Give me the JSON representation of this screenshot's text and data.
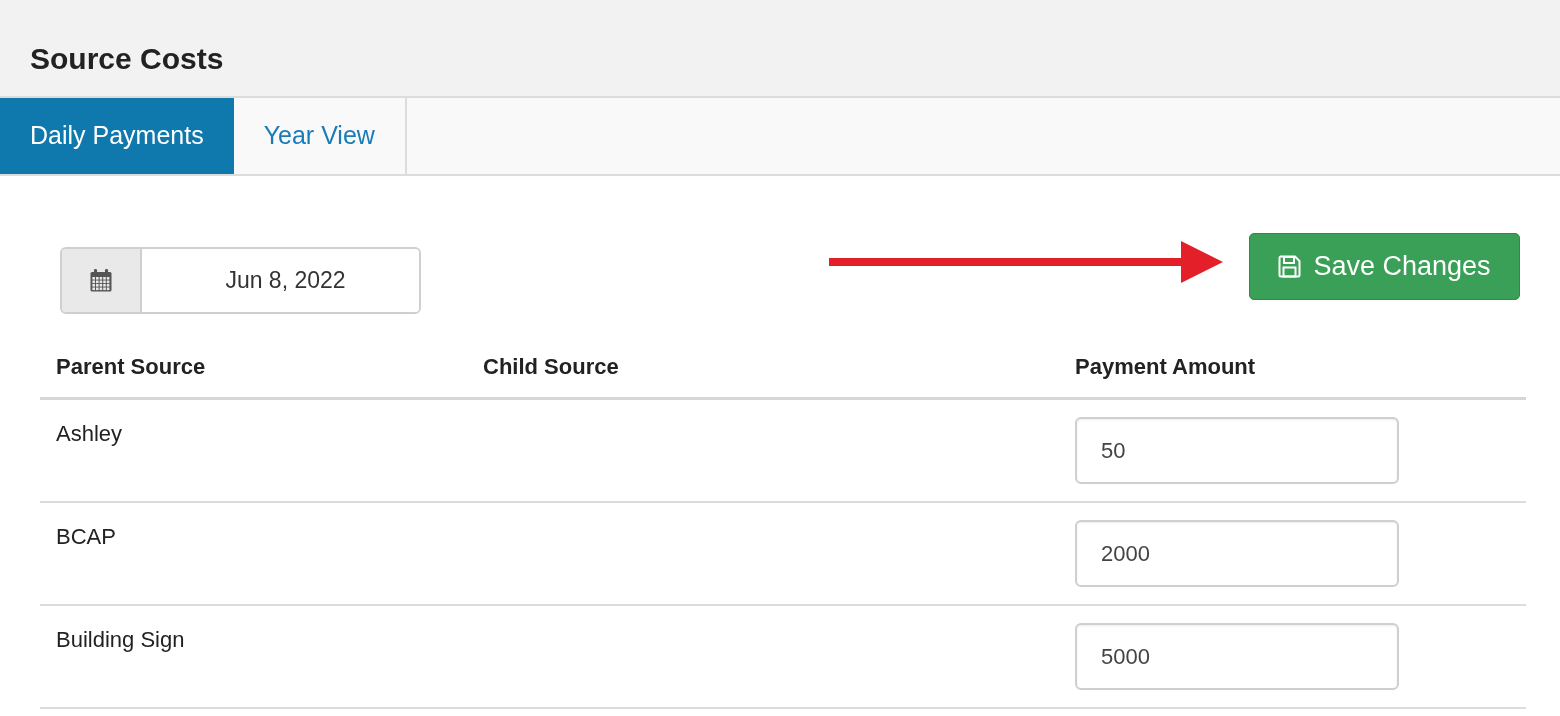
{
  "page": {
    "title": "Source Costs"
  },
  "tabs": [
    {
      "label": "Daily Payments",
      "selected": true
    },
    {
      "label": "Year View",
      "selected": false
    }
  ],
  "date_field": {
    "value": "Jun 8, 2022"
  },
  "save_button": {
    "label": "Save Changes"
  },
  "table": {
    "columns": [
      "Parent Source",
      "Child Source",
      "Payment Amount"
    ],
    "rows": [
      {
        "parent_source": "Ashley",
        "payment_amount": "50"
      },
      {
        "parent_source": "BCAP",
        "payment_amount": "2000"
      },
      {
        "parent_source": "Building Sign",
        "payment_amount": "5000"
      }
    ]
  }
}
